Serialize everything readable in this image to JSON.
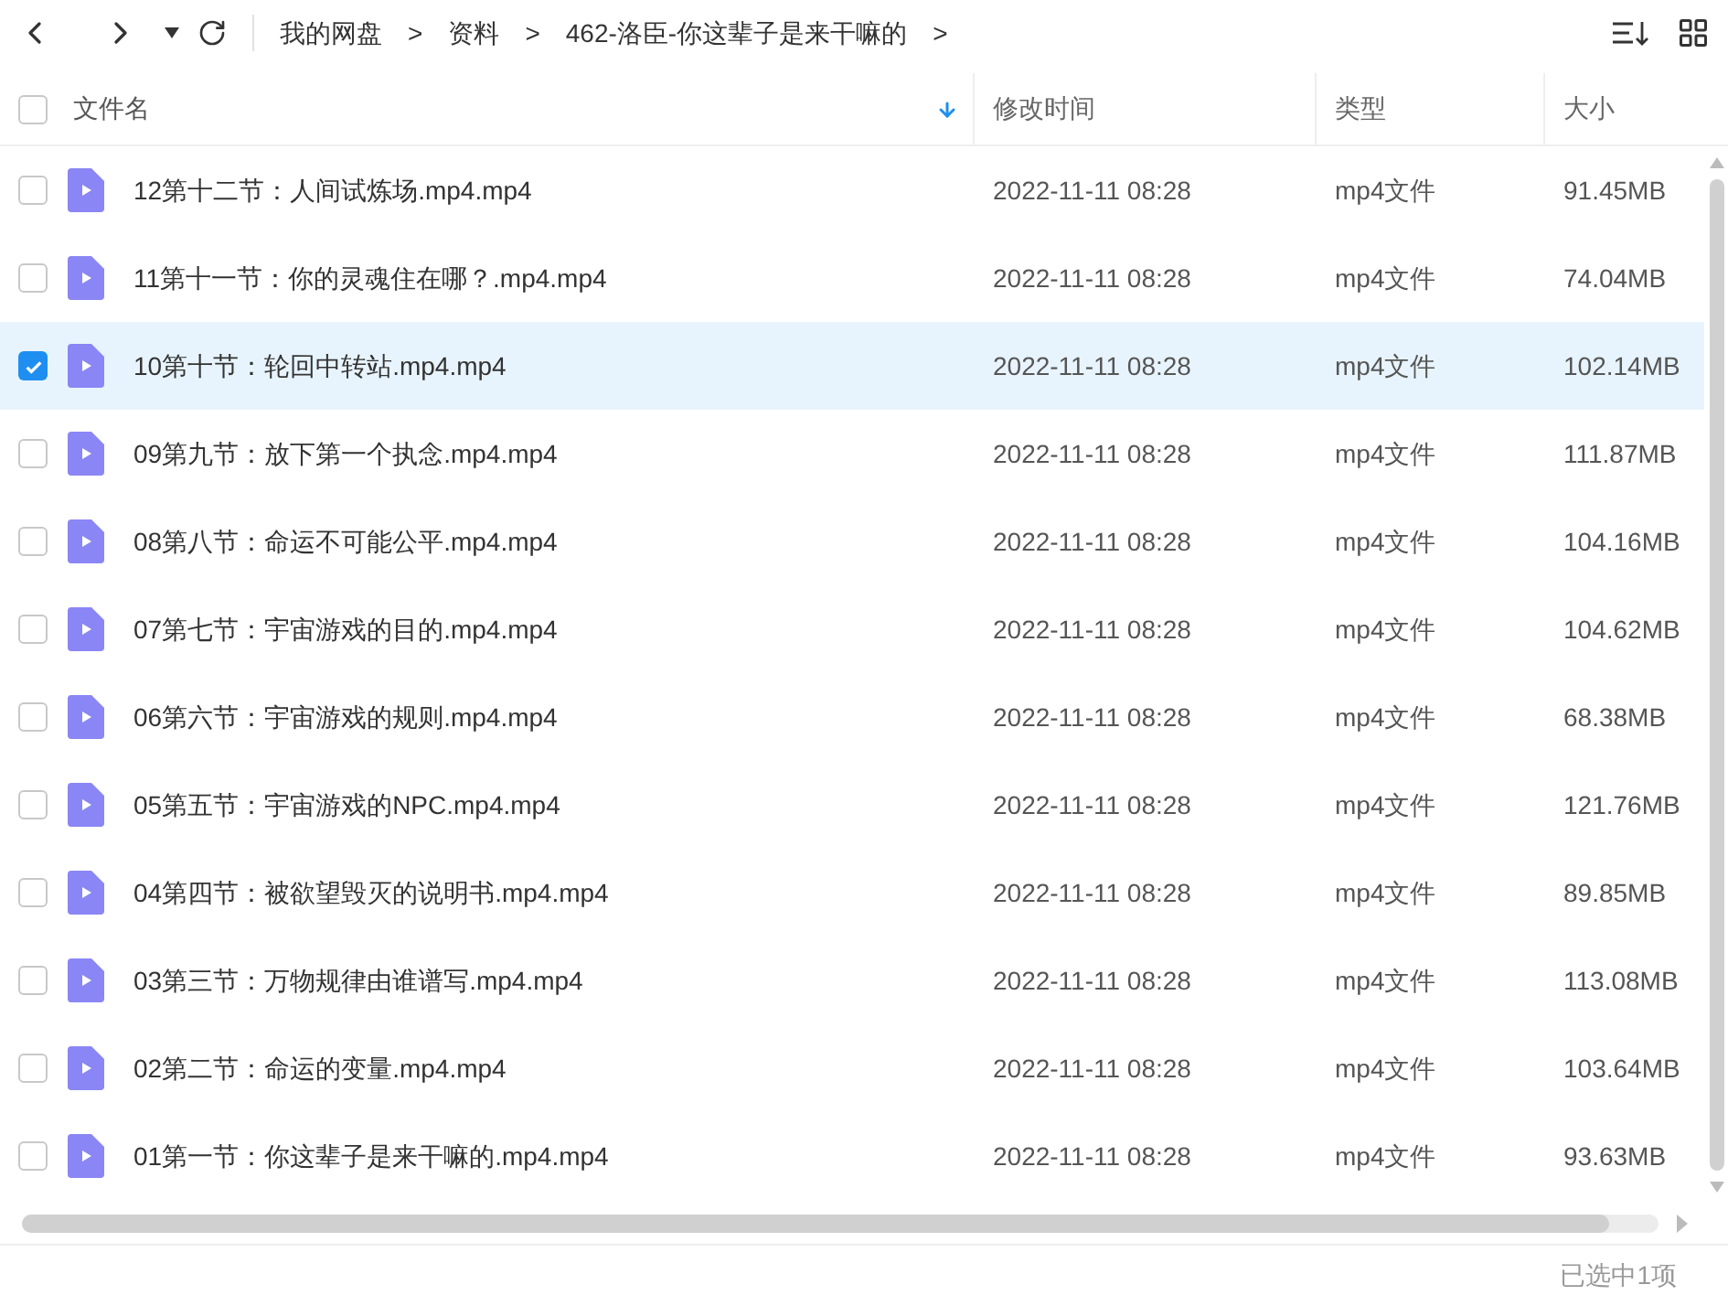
{
  "breadcrumb": [
    {
      "label": "我的网盘",
      "separator": ">"
    },
    {
      "label": "资料",
      "separator": ">"
    },
    {
      "label": "462-洛臣-你这辈子是来干嘛的",
      "separator": ">"
    }
  ],
  "table": {
    "select_all": {
      "checked": false
    },
    "columns": [
      {
        "label": "文件名",
        "sorted": true
      },
      {
        "label": "修改时间",
        "sorted": false
      },
      {
        "label": "类型",
        "sorted": false
      },
      {
        "label": "大小",
        "sorted": false
      }
    ],
    "rows": [
      {
        "name": "12第十二节：人间试炼场.mp4.mp4",
        "modified": "2022-11-11 08:28",
        "type": "mp4文件",
        "size": "91.45MB",
        "selected": false
      },
      {
        "name": "11第十一节：你的灵魂住在哪？.mp4.mp4",
        "modified": "2022-11-11 08:28",
        "type": "mp4文件",
        "size": "74.04MB",
        "selected": false
      },
      {
        "name": "10第十节：轮回中转站.mp4.mp4",
        "modified": "2022-11-11 08:28",
        "type": "mp4文件",
        "size": "102.14MB",
        "selected": true
      },
      {
        "name": "09第九节：放下第一个执念.mp4.mp4",
        "modified": "2022-11-11 08:28",
        "type": "mp4文件",
        "size": "111.87MB",
        "selected": false
      },
      {
        "name": "08第八节：命运不可能公平.mp4.mp4",
        "modified": "2022-11-11 08:28",
        "type": "mp4文件",
        "size": "104.16MB",
        "selected": false
      },
      {
        "name": "07第七节：宇宙游戏的目的.mp4.mp4",
        "modified": "2022-11-11 08:28",
        "type": "mp4文件",
        "size": "104.62MB",
        "selected": false
      },
      {
        "name": "06第六节：宇宙游戏的规则.mp4.mp4",
        "modified": "2022-11-11 08:28",
        "type": "mp4文件",
        "size": "68.38MB",
        "selected": false
      },
      {
        "name": "05第五节：宇宙游戏的NPC.mp4.mp4",
        "modified": "2022-11-11 08:28",
        "type": "mp4文件",
        "size": "121.76MB",
        "selected": false
      },
      {
        "name": "04第四节：被欲望毁灭的说明书.mp4.mp4",
        "modified": "2022-11-11 08:28",
        "type": "mp4文件",
        "size": "89.85MB",
        "selected": false
      },
      {
        "name": "03第三节：万物规律由谁谱写.mp4.mp4",
        "modified": "2022-11-11 08:28",
        "type": "mp4文件",
        "size": "113.08MB",
        "selected": false
      },
      {
        "name": "02第二节：命运的变量.mp4.mp4",
        "modified": "2022-11-11 08:28",
        "type": "mp4文件",
        "size": "103.64MB",
        "selected": false
      },
      {
        "name": "01第一节：你这辈子是来干嘛的.mp4.mp4",
        "modified": "2022-11-11 08:28",
        "type": "mp4文件",
        "size": "93.63MB",
        "selected": false
      }
    ]
  },
  "status_bar": {
    "text": "已选中1项"
  }
}
